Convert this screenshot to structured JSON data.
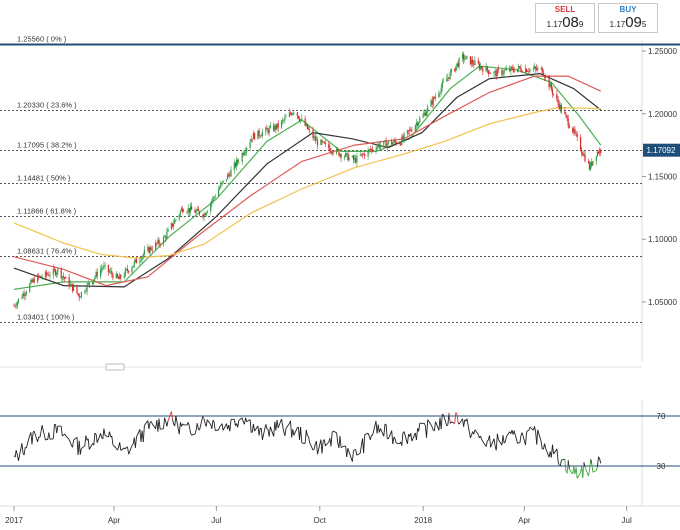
{
  "quotes": {
    "sell": {
      "label": "SELL",
      "prefix": "1.17",
      "big": "08",
      "small": "9"
    },
    "buy": {
      "label": "BUY",
      "prefix": "1.17",
      "big": "09",
      "small": "5"
    }
  },
  "price_tag": "1.17092",
  "colors": {
    "price_tag_bg": "#1f4e79",
    "fib_top_line": "#1f4e79",
    "candle_up": "#2e9e44",
    "candle_down": "#d62828",
    "sma_fast": "#4caf50",
    "sma_mid": "#333333",
    "sma_slow_red": "#e05a5a",
    "sma_200": "#f2c14e",
    "rsi_line": "#222222",
    "rsi_overbought": "#e03030",
    "rsi_oversold": "#3aa83a",
    "rsi_levels": "#1f4e79"
  },
  "chart_data": [
    {
      "type": "candlestick",
      "instrument_note": "",
      "x_axis": {
        "ticks": [
          "2017",
          "Apr",
          "Jul",
          "Oct",
          "2018",
          "Apr",
          "Jul"
        ]
      },
      "y_axis": {
        "ticks": [
          "1.25000",
          "1.20000",
          "1.15000",
          "1.10000",
          "1.05000"
        ],
        "range": [
          1.015,
          1.26
        ]
      },
      "current_price": 1.17092,
      "fibonacci_levels": [
        {
          "price": 1.2556,
          "label": "1.25560 ( 0% )"
        },
        {
          "price": 1.2033,
          "label": "1.20330 ( 23.6% )"
        },
        {
          "price": 1.17095,
          "label": "1.17095 ( 38.2% )"
        },
        {
          "price": 1.14481,
          "label": "1.14481 ( 50% )"
        },
        {
          "price": 1.11866,
          "label": "1.11866 ( 61.8% )"
        },
        {
          "price": 1.08631,
          "label": "1.08631 ( 76.4% )"
        },
        {
          "price": 1.03401,
          "label": "1.03401 ( 100% )"
        }
      ],
      "price_path": [
        [
          "2017-01-02",
          1.047
        ],
        [
          "2017-01-20",
          1.068
        ],
        [
          "2017-02-10",
          1.075
        ],
        [
          "2017-03-01",
          1.055
        ],
        [
          "2017-03-22",
          1.078
        ],
        [
          "2017-04-05",
          1.068
        ],
        [
          "2017-04-28",
          1.089
        ],
        [
          "2017-05-15",
          1.1
        ],
        [
          "2017-06-01",
          1.125
        ],
        [
          "2017-06-20",
          1.12
        ],
        [
          "2017-07-03",
          1.14
        ],
        [
          "2017-07-20",
          1.162
        ],
        [
          "2017-08-02",
          1.182
        ],
        [
          "2017-08-25",
          1.19
        ],
        [
          "2017-09-08",
          1.203
        ],
        [
          "2017-09-28",
          1.178
        ],
        [
          "2017-10-15",
          1.17
        ],
        [
          "2017-11-01",
          1.163
        ],
        [
          "2017-11-22",
          1.175
        ],
        [
          "2017-12-12",
          1.178
        ],
        [
          "2018-01-02",
          1.2
        ],
        [
          "2018-01-22",
          1.228
        ],
        [
          "2018-02-05",
          1.245
        ],
        [
          "2018-02-20",
          1.238
        ],
        [
          "2018-03-05",
          1.232
        ],
        [
          "2018-03-26",
          1.236
        ],
        [
          "2018-04-17",
          1.235
        ],
        [
          "2018-04-30",
          1.21
        ],
        [
          "2018-05-15",
          1.185
        ],
        [
          "2018-05-29",
          1.157
        ],
        [
          "2018-06-04",
          1.169
        ],
        [
          "2018-06-08",
          1.171
        ]
      ],
      "moving_averages": [
        {
          "name": "",
          "color": "sma_fast",
          "path": [
            [
              "2017-01-02",
              1.06
            ],
            [
              "2017-02-15",
              1.066
            ],
            [
              "2017-04-10",
              1.066
            ],
            [
              "2017-05-20",
              1.102
            ],
            [
              "2017-07-01",
              1.132
            ],
            [
              "2017-08-15",
              1.178
            ],
            [
              "2017-09-15",
              1.195
            ],
            [
              "2017-10-20",
              1.17
            ],
            [
              "2017-11-20",
              1.17
            ],
            [
              "2017-12-20",
              1.18
            ],
            [
              "2018-01-25",
              1.22
            ],
            [
              "2018-02-20",
              1.238
            ],
            [
              "2018-03-25",
              1.235
            ],
            [
              "2018-04-25",
              1.225
            ],
            [
              "2018-05-20",
              1.198
            ],
            [
              "2018-06-08",
              1.175
            ]
          ]
        },
        {
          "name": "",
          "color": "sma_mid",
          "path": [
            [
              "2017-01-02",
              1.077
            ],
            [
              "2017-02-15",
              1.063
            ],
            [
              "2017-04-10",
              1.062
            ],
            [
              "2017-05-20",
              1.085
            ],
            [
              "2017-07-01",
              1.118
            ],
            [
              "2017-08-15",
              1.16
            ],
            [
              "2017-09-25",
              1.185
            ],
            [
              "2017-10-30",
              1.18
            ],
            [
              "2017-12-01",
              1.173
            ],
            [
              "2017-12-31",
              1.185
            ],
            [
              "2018-01-31",
              1.213
            ],
            [
              "2018-03-01",
              1.228
            ],
            [
              "2018-04-15",
              1.232
            ],
            [
              "2018-05-15",
              1.22
            ],
            [
              "2018-06-08",
              1.203
            ]
          ]
        },
        {
          "name": "",
          "color": "sma_slow_red",
          "path": [
            [
              "2017-01-02",
              1.086
            ],
            [
              "2017-02-15",
              1.076
            ],
            [
              "2017-03-25",
              1.063
            ],
            [
              "2017-05-01",
              1.07
            ],
            [
              "2017-06-15",
              1.103
            ],
            [
              "2017-08-01",
              1.135
            ],
            [
              "2017-09-15",
              1.162
            ],
            [
              "2017-11-01",
              1.175
            ],
            [
              "2017-12-15",
              1.18
            ],
            [
              "2018-01-20",
              1.198
            ],
            [
              "2018-03-01",
              1.217
            ],
            [
              "2018-04-10",
              1.23
            ],
            [
              "2018-05-10",
              1.23
            ],
            [
              "2018-06-08",
              1.218
            ]
          ]
        },
        {
          "name": "",
          "color": "sma_200",
          "path": [
            [
              "2017-01-02",
              1.113
            ],
            [
              "2017-02-15",
              1.097
            ],
            [
              "2017-03-20",
              1.088
            ],
            [
              "2017-04-20",
              1.085
            ],
            [
              "2017-05-20",
              1.087
            ],
            [
              "2017-06-20",
              1.096
            ],
            [
              "2017-08-01",
              1.121
            ],
            [
              "2017-09-15",
              1.14
            ],
            [
              "2017-11-01",
              1.157
            ],
            [
              "2017-12-15",
              1.168
            ],
            [
              "2018-01-20",
              1.178
            ],
            [
              "2018-03-01",
              1.192
            ],
            [
              "2018-04-10",
              1.201
            ],
            [
              "2018-05-01",
              1.205
            ],
            [
              "2018-06-08",
              1.204
            ]
          ]
        }
      ]
    },
    {
      "type": "line",
      "indicator": "",
      "y_axis": {
        "ticks": [
          "70",
          "30"
        ],
        "range": [
          15,
          85
        ]
      },
      "levels": [
        70,
        30
      ],
      "path": [
        [
          "2017-01-02",
          35
        ],
        [
          "2017-01-20",
          55
        ],
        [
          "2017-02-10",
          58
        ],
        [
          "2017-03-01",
          45
        ],
        [
          "2017-03-22",
          57
        ],
        [
          "2017-04-10",
          40
        ],
        [
          "2017-05-01",
          60
        ],
        [
          "2017-05-20",
          68
        ],
        [
          "2017-06-05",
          58
        ],
        [
          "2017-06-20",
          67
        ],
        [
          "2017-07-10",
          62
        ],
        [
          "2017-07-25",
          70
        ],
        [
          "2017-08-10",
          55
        ],
        [
          "2017-08-25",
          62
        ],
        [
          "2017-09-10",
          58
        ],
        [
          "2017-09-30",
          45
        ],
        [
          "2017-10-15",
          52
        ],
        [
          "2017-11-01",
          38
        ],
        [
          "2017-11-20",
          60
        ],
        [
          "2017-12-10",
          52
        ],
        [
          "2017-12-31",
          58
        ],
        [
          "2018-01-20",
          66
        ],
        [
          "2018-02-01",
          70
        ],
        [
          "2018-02-15",
          55
        ],
        [
          "2018-03-01",
          48
        ],
        [
          "2018-03-20",
          52
        ],
        [
          "2018-04-10",
          55
        ],
        [
          "2018-04-30",
          38
        ],
        [
          "2018-05-15",
          25
        ],
        [
          "2018-05-29",
          28
        ],
        [
          "2018-06-04",
          32
        ],
        [
          "2018-06-08",
          38
        ]
      ]
    }
  ]
}
